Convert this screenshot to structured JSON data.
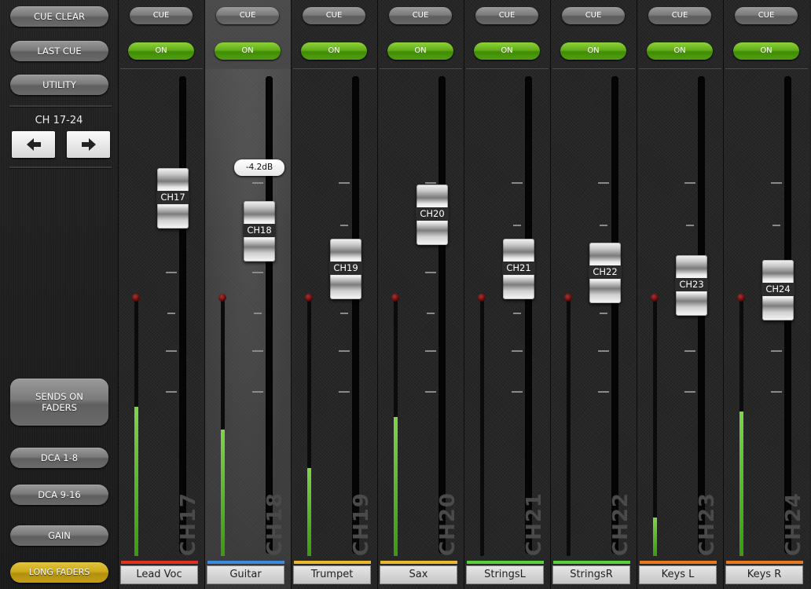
{
  "sidebar": {
    "cue_clear": "CUE CLEAR",
    "last_cue": "LAST CUE",
    "utility": "UTILITY",
    "bank_label": "CH 17-24",
    "sends_on_faders": "SENDS ON\nFADERS",
    "dca_1_8": "DCA 1-8",
    "dca_9_16": "DCA 9-16",
    "gain": "GAIN",
    "long_faders": "LONG FADERS"
  },
  "colors": {
    "long_faders_button": "#cfab1a",
    "on_button": "#62ad18",
    "meter": "#5ec02a"
  },
  "channels": [
    {
      "cue": "CUE",
      "on": "ON",
      "label": "CH17",
      "vlabel": "CH17",
      "name": "Lead Voc",
      "color": "#e03020",
      "meter_level": 0.58,
      "fader_level": 0.78
    },
    {
      "cue": "CUE",
      "on": "ON",
      "label": "CH18",
      "vlabel": "CH18",
      "name": "Guitar",
      "color": "#3a8ae0",
      "meter_level": 0.49,
      "fader_level": 0.7,
      "db": "-4.2dB"
    },
    {
      "cue": "CUE",
      "on": "ON",
      "label": "CH19",
      "vlabel": "CH19",
      "name": "Trumpet",
      "color": "#e8b830",
      "meter_level": 0.34,
      "fader_level": 0.61
    },
    {
      "cue": "CUE",
      "on": "ON",
      "label": "CH20",
      "vlabel": "CH20",
      "name": "Sax",
      "color": "#e8b830",
      "meter_level": 0.54,
      "fader_level": 0.74
    },
    {
      "cue": "CUE",
      "on": "ON",
      "label": "CH21",
      "vlabel": "CH21",
      "name": "StringsL",
      "color": "#58d038",
      "meter_level": 0,
      "fader_level": 0.61
    },
    {
      "cue": "CUE",
      "on": "ON",
      "label": "CH22",
      "vlabel": "CH22",
      "name": "StringsR",
      "color": "#58d038",
      "meter_level": 0,
      "fader_level": 0.6
    },
    {
      "cue": "CUE",
      "on": "ON",
      "label": "CH23",
      "vlabel": "CH23",
      "name": "Keys L",
      "color": "#e87820",
      "meter_level": 0.15,
      "fader_level": 0.57
    },
    {
      "cue": "CUE",
      "on": "ON",
      "label": "CH24",
      "vlabel": "CH24",
      "name": "Keys R",
      "color": "#e87820",
      "meter_level": 0.56,
      "fader_level": 0.56
    }
  ]
}
